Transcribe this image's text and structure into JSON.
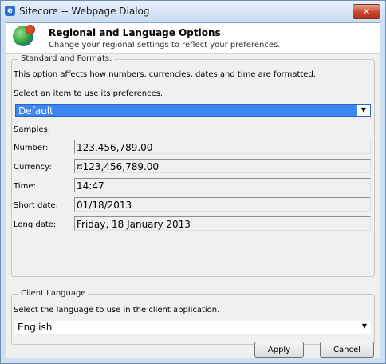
{
  "window": {
    "title": "Sitecore -- Webpage Dialog",
    "close_glyph": "✕"
  },
  "header": {
    "title": "Regional and Language Options",
    "subtitle": "Change your regional settings to reflect your preferences.",
    "icon": "globe-icon"
  },
  "standard_formats": {
    "legend": "Standard and Formats:",
    "description": "This option affects how numbers, currencies, dates and time are formatted.",
    "select_label": "Select an item to use its preferences.",
    "selected_value": "Default",
    "samples_label": "Samples:",
    "samples": [
      {
        "label": "Number:",
        "value": "123,456,789.00"
      },
      {
        "label": "Currency:",
        "value": "¤123,456,789.00"
      },
      {
        "label": "Time:",
        "value": "14:47"
      },
      {
        "label": "Short date:",
        "value": "01/18/2013"
      },
      {
        "label": "Long date:",
        "value": "Friday, 18 January 2013"
      }
    ]
  },
  "client_language": {
    "legend": "Client Language",
    "description": "Select the language to use in the client application.",
    "selected_value": "English"
  },
  "buttons": {
    "apply": "Apply",
    "cancel": "Cancel"
  },
  "dropdown_arrow": "▼",
  "colors": {
    "selection": "#3b86f1",
    "dialog_bg": "#f0f0f0",
    "frame": "#cfe0f2",
    "close": "#c9442b"
  }
}
